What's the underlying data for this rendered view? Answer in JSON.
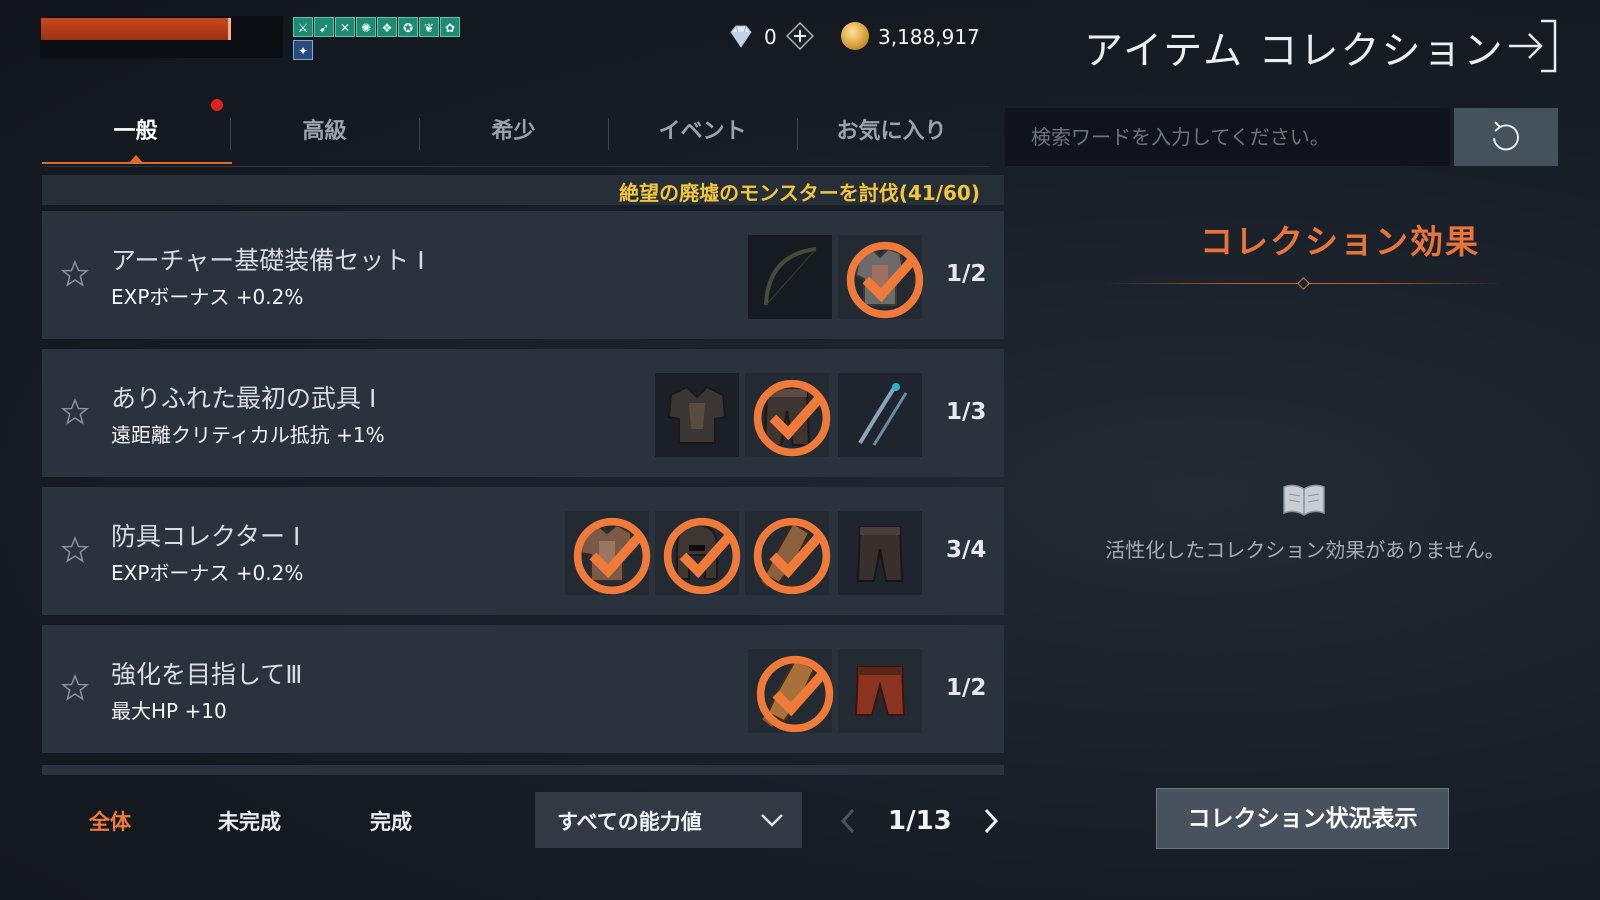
{
  "player": {
    "hp_fraction": 0.79
  },
  "buffs": [
    "buff-icon-1",
    "buff-icon-2",
    "buff-icon-3",
    "buff-icon-4",
    "buff-icon-5",
    "buff-icon-6",
    "buff-icon-7",
    "buff-icon-8",
    "buff-icon-9"
  ],
  "currency": {
    "gems": "0",
    "gold": "3,188,917"
  },
  "header": {
    "title": "アイテム コレクション"
  },
  "tabs": [
    {
      "label": "一般",
      "active": true,
      "has_notification": true
    },
    {
      "label": "高級"
    },
    {
      "label": "希少"
    },
    {
      "label": "イベント"
    },
    {
      "label": "お気に入り"
    }
  ],
  "search": {
    "placeholder": "検索ワードを入力してください。"
  },
  "quest": {
    "text": "絶望の廃墟のモンスターを討伐(41/60)"
  },
  "collections": [
    {
      "name": "アーチャー基礎装備セット Ⅰ",
      "bonus": "EXPボーナス +0.2%",
      "progress": "1/2",
      "items": [
        {
          "icon": "bow-icon",
          "done": false
        },
        {
          "icon": "chest-armor-icon",
          "done": true
        }
      ]
    },
    {
      "name": "ありふれた最初の武具 Ⅰ",
      "bonus": "遠距離クリティカル抵抗 +1%",
      "progress": "1/3",
      "items": [
        {
          "icon": "dark-chest-armor-icon",
          "done": false
        },
        {
          "icon": "leather-pants-icon",
          "done": true
        },
        {
          "icon": "dual-blades-icon",
          "done": false
        }
      ]
    },
    {
      "name": "防具コレクター Ⅰ",
      "bonus": "EXPボーナス +0.2%",
      "progress": "3/4",
      "items": [
        {
          "icon": "bronze-chest-armor-icon",
          "done": true
        },
        {
          "icon": "helmet-icon",
          "done": true
        },
        {
          "icon": "gauntlet-icon",
          "done": true
        },
        {
          "icon": "dark-pants-icon",
          "done": false
        }
      ]
    },
    {
      "name": "強化を目指してⅢ",
      "bonus": "最大HP +10",
      "progress": "1/2",
      "items": [
        {
          "icon": "leather-glove-icon",
          "done": true
        },
        {
          "icon": "red-pants-icon",
          "done": false
        }
      ]
    }
  ],
  "effects": {
    "title": "コレクション効果",
    "empty_message": "活性化したコレクション効果がありません。"
  },
  "footer": {
    "filters": [
      "全体",
      "未完成",
      "完成"
    ],
    "active_filter": "全体",
    "stat_dropdown": "すべての能力値",
    "page": "1/13",
    "status_button": "コレクション状況表示"
  },
  "colors": {
    "accent": "#e9743a",
    "quest": "#f2c53d",
    "card": "#2a323d",
    "buff": "#1f8a73"
  }
}
